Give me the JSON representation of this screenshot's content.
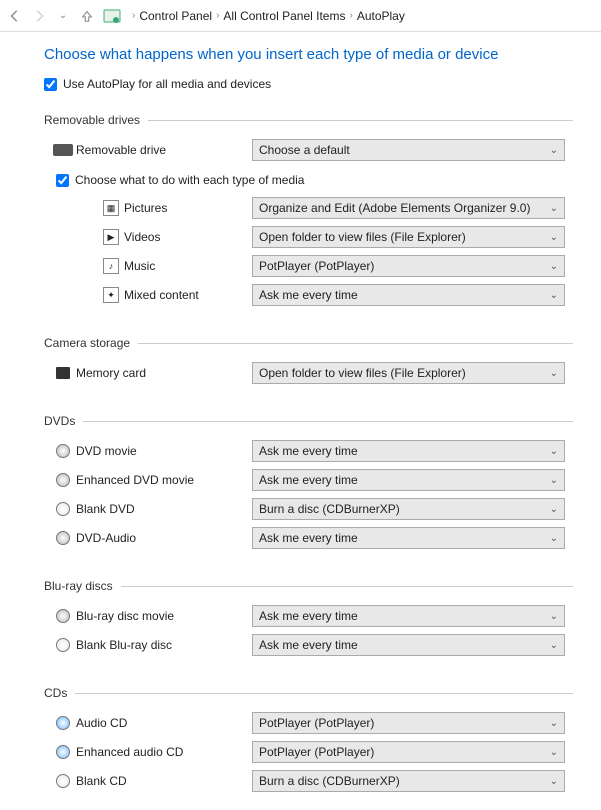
{
  "breadcrumb": {
    "control_panel": "Control Panel",
    "all_items": "All Control Panel Items",
    "autoplay": "AutoPlay"
  },
  "heading": "Choose what happens when you insert each type of media or device",
  "use_autoplay_label": "Use AutoPlay for all media and devices",
  "groups": {
    "removable": {
      "title": "Removable drives",
      "drive_label": "Removable drive",
      "drive_value": "Choose a default",
      "sub_check": "Choose what to do with each type of media",
      "pictures": {
        "label": "Pictures",
        "value": "Organize and Edit (Adobe Elements Organizer 9.0)"
      },
      "videos": {
        "label": "Videos",
        "value": "Open folder to view files (File Explorer)"
      },
      "music": {
        "label": "Music",
        "value": "PotPlayer (PotPlayer)"
      },
      "mixed": {
        "label": "Mixed content",
        "value": "Ask me every time"
      }
    },
    "camera": {
      "title": "Camera storage",
      "memory": {
        "label": "Memory card",
        "value": "Open folder to view files (File Explorer)"
      }
    },
    "dvds": {
      "title": "DVDs",
      "movie": {
        "label": "DVD movie",
        "value": "Ask me every time"
      },
      "enhanced": {
        "label": "Enhanced DVD movie",
        "value": "Ask me every time"
      },
      "blank": {
        "label": "Blank DVD",
        "value": "Burn a disc (CDBurnerXP)"
      },
      "audio": {
        "label": "DVD-Audio",
        "value": "Ask me every time"
      }
    },
    "bluray": {
      "title": "Blu-ray discs",
      "movie": {
        "label": "Blu-ray disc movie",
        "value": "Ask me every time"
      },
      "blank": {
        "label": "Blank Blu-ray disc",
        "value": "Ask me every time"
      }
    },
    "cds": {
      "title": "CDs",
      "audio": {
        "label": "Audio CD",
        "value": "PotPlayer (PotPlayer)"
      },
      "enhanced": {
        "label": "Enhanced audio CD",
        "value": "PotPlayer (PotPlayer)"
      },
      "blank": {
        "label": "Blank CD",
        "value": "Burn a disc (CDBurnerXP)"
      }
    }
  }
}
